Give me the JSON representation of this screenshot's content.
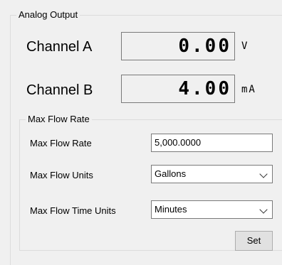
{
  "analog_output": {
    "title": "Analog Output",
    "channel_a": {
      "label": "Channel A",
      "value": "0.00",
      "unit": "V"
    },
    "channel_b": {
      "label": "Channel B",
      "value": "4.00",
      "unit": "mA"
    }
  },
  "max_flow": {
    "title": "Max Flow Rate",
    "rate": {
      "label": "Max Flow Rate",
      "value": "5,000.0000"
    },
    "units": {
      "label": "Max Flow Units",
      "selected": "Gallons"
    },
    "time_units": {
      "label": "Max Flow Time Units",
      "selected": "Minutes"
    },
    "set_label": "Set"
  },
  "icons": {
    "dropdown": "chevron-down-icon"
  }
}
